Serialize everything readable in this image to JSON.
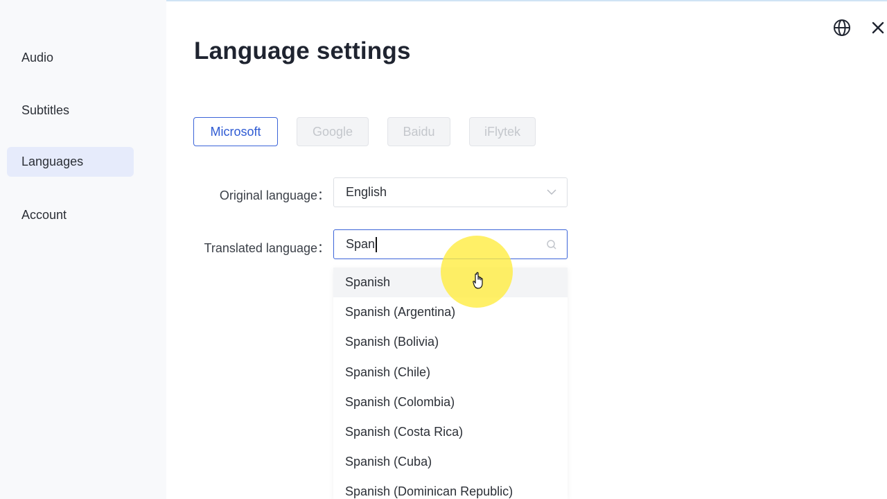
{
  "sidebar": {
    "items": [
      {
        "label": "Audio"
      },
      {
        "label": "Subtitles"
      },
      {
        "label": "Languages"
      },
      {
        "label": "Account"
      }
    ]
  },
  "header": {
    "title": "Language settings",
    "icons": [
      "globe-icon",
      "close-icon"
    ]
  },
  "providers": [
    {
      "label": "Microsoft"
    },
    {
      "label": "Google"
    },
    {
      "label": "Baidu"
    },
    {
      "label": "iFlytek"
    }
  ],
  "form": {
    "original_label": "Original language：",
    "original_value": "English",
    "translated_label": "Translated language：",
    "translated_value": "Span"
  },
  "dropdown": {
    "options": [
      "Spanish",
      "Spanish (Argentina)",
      "Spanish (Bolivia)",
      "Spanish (Chile)",
      "Spanish (Colombia)",
      "Spanish (Costa Rica)",
      "Spanish (Cuba)",
      "Spanish (Dominican Republic)"
    ]
  },
  "colors": {
    "accent": "#3a63d8",
    "active_nav_bg": "#e6ebfb",
    "sidebar_bg": "#f8f9fb",
    "cursor_highlight": "#ffec3c"
  }
}
